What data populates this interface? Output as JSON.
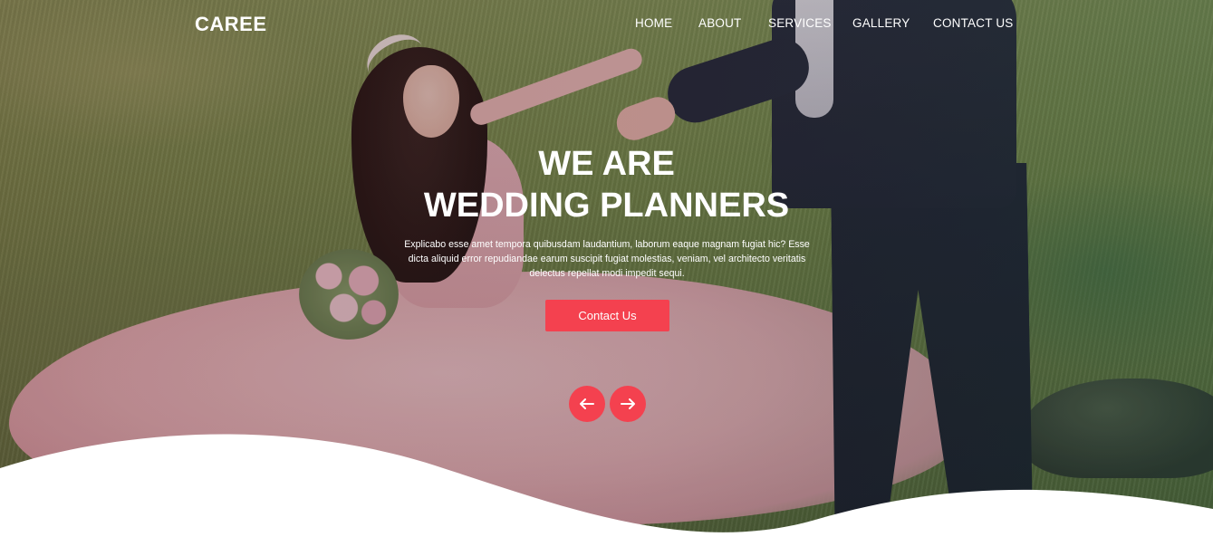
{
  "brand": {
    "logo": "CAREE"
  },
  "nav": {
    "items": [
      {
        "label": "HOME"
      },
      {
        "label": "ABOUT"
      },
      {
        "label": "SERVICES"
      },
      {
        "label": "GALLERY"
      },
      {
        "label": "CONTACT US"
      }
    ]
  },
  "hero": {
    "title_line1": "WE ARE",
    "title_line2": "WEDDING PLANNERS",
    "text": "Explicabo esse amet tempora quibusdam laudantium, laborum eaque magnam fugiat hic? Esse dicta aliquid error repudiandae earum suscipit fugiat molestias, veniam, vel architecto veritatis delectus repellat modi impedit sequi.",
    "cta_label": "Contact Us",
    "prev_icon": "arrow-left-icon",
    "next_icon": "arrow-right-icon"
  },
  "colors": {
    "accent": "#f4414f",
    "text_light": "#ffffff",
    "background": "#ffffff"
  }
}
